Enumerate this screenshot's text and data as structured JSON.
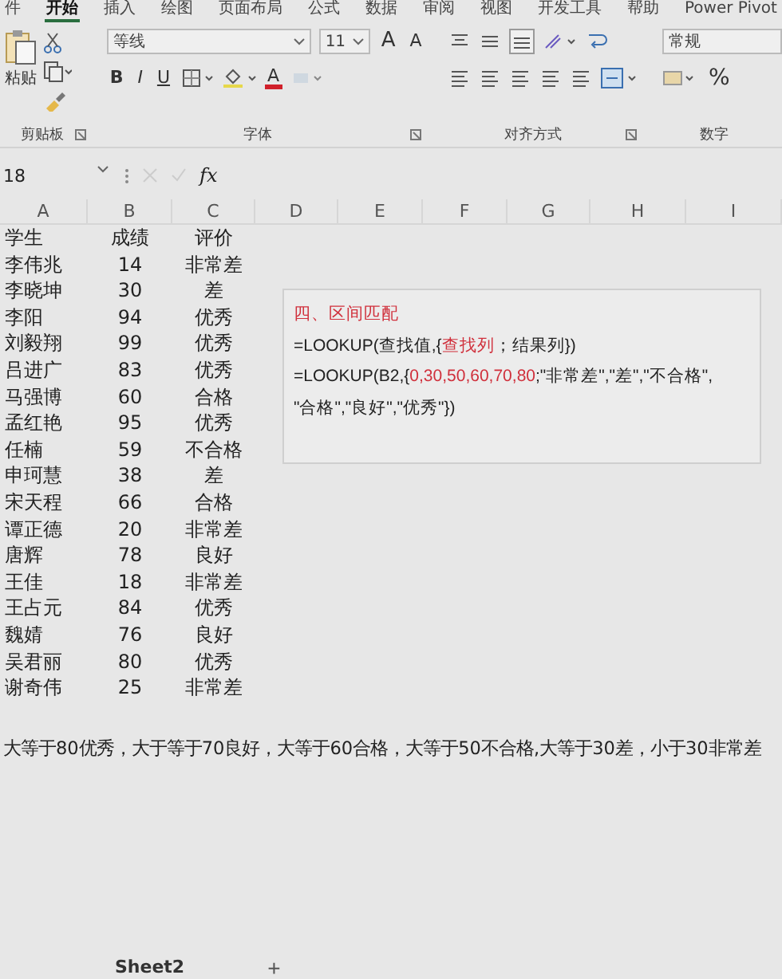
{
  "ribbon_tabs": [
    {
      "label": "件",
      "selected": false
    },
    {
      "label": "开始",
      "selected": true
    },
    {
      "label": "插入",
      "selected": false
    },
    {
      "label": "绘图",
      "selected": false
    },
    {
      "label": "页面布局",
      "selected": false
    },
    {
      "label": "公式",
      "selected": false
    },
    {
      "label": "数据",
      "selected": false
    },
    {
      "label": "审阅",
      "selected": false
    },
    {
      "label": "视图",
      "selected": false
    },
    {
      "label": "开发工具",
      "selected": false
    },
    {
      "label": "帮助",
      "selected": false
    },
    {
      "label": "Power Pivot",
      "selected": false
    }
  ],
  "ribbon": {
    "paste_label": "粘贴",
    "font_name": "等线",
    "font_size": "11",
    "grow_font": "A",
    "shrink_font": "A",
    "format_buttons": [
      "B",
      "I",
      "U"
    ],
    "font_color": "A",
    "number_format": "常规",
    "percent": "%",
    "group_labels": [
      "剪贴板",
      "字体",
      "对齐方式",
      "数字"
    ]
  },
  "formula_bar": {
    "name_box": "18",
    "fx": "fx"
  },
  "columns": [
    "A",
    "B",
    "C",
    "D",
    "E",
    "F",
    "G",
    "H",
    "I"
  ],
  "rows": [
    [
      "学生",
      "成绩",
      "评价"
    ],
    [
      "李伟兆",
      "14",
      "非常差"
    ],
    [
      "李晓坤",
      "30",
      "差"
    ],
    [
      "李阳",
      "94",
      "优秀"
    ],
    [
      "刘毅翔",
      "99",
      "优秀"
    ],
    [
      "吕进广",
      "83",
      "优秀"
    ],
    [
      "马强博",
      "60",
      "合格"
    ],
    [
      "孟红艳",
      "95",
      "优秀"
    ],
    [
      "任楠",
      "59",
      "不合格"
    ],
    [
      "申珂慧",
      "38",
      "差"
    ],
    [
      "宋天程",
      "66",
      "合格"
    ],
    [
      "谭正德",
      "20",
      "非常差"
    ],
    [
      "唐辉",
      "78",
      "良好"
    ],
    [
      "王佳",
      "18",
      "非常差"
    ],
    [
      "王占元",
      "84",
      "优秀"
    ],
    [
      "魏婧",
      "76",
      "良好"
    ],
    [
      "吴君丽",
      "80",
      "优秀"
    ],
    [
      "谢奇伟",
      "25",
      "非常差"
    ]
  ],
  "text_box": {
    "lines": [
      [
        {
          "text": "四、区间匹配",
          "emphasis": true
        }
      ],
      [
        {
          "text": "=LOOKUP(查找值,{",
          "emphasis": false
        },
        {
          "text": "查找列",
          "emphasis": true
        },
        {
          "text": "；结果列})",
          "emphasis": false
        }
      ],
      [
        {
          "text": "=LOOKUP(B2,{",
          "emphasis": false
        },
        {
          "text": "0,30,50,60,70,80",
          "emphasis": true
        },
        {
          "text": ";\"非常差\",\"差\",\"不合格\",",
          "emphasis": false
        }
      ],
      [
        {
          "text": "\"合格\",\"良好\",\"优秀\"})",
          "emphasis": false
        }
      ]
    ]
  },
  "note": "大等于80优秀，大于等于70良好，大等于60合格，大等于50不合格,大等于30差，小于30非常差",
  "sheet_tabs": [
    {
      "label": "Sheet2",
      "selected": true
    }
  ],
  "add_sheet": "+"
}
